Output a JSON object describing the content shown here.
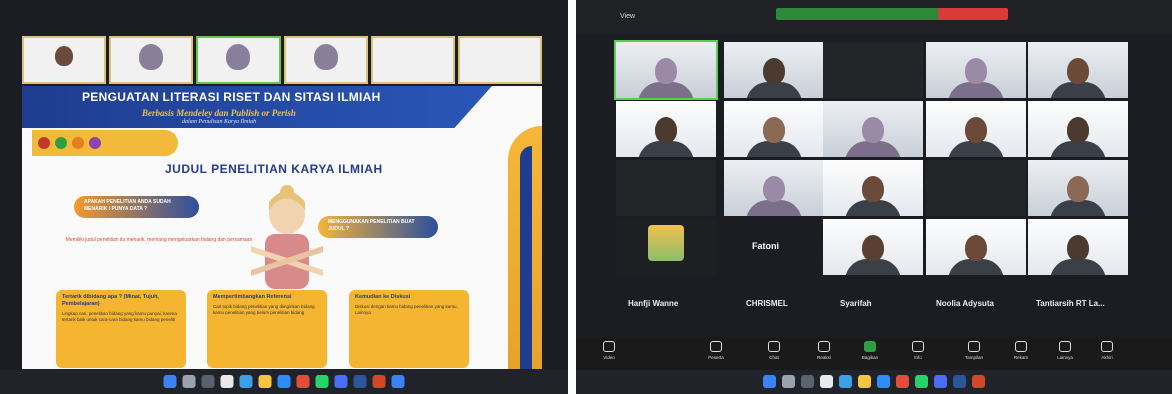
{
  "left": {
    "participants": [
      {
        "name": ""
      },
      {
        "name": ""
      },
      {
        "name": ""
      },
      {
        "name": ""
      },
      {
        "name": ""
      },
      {
        "name": ""
      }
    ],
    "slide": {
      "title": "PENGUATAN LITERASI RISET DAN SITASI ILMIAH",
      "subtitle": "Berbasis Mendeley dan Publish or Perish",
      "subtitle2": "dalam Penulisan Karya Ilmiah",
      "heading": "JUDUL PENELITIAN KARYA ILMIAH",
      "pill_a": "APAKAH PENELITIAN ANDA SUDAH MENARIK / PUNYA DATA ?",
      "pill_b": "MENGGUNAKAN PENELITIAN BUAT JUDUL ?",
      "note": "Memiliki judul penelitian itu menarik, memang mengeluarkan bidang dan persamaan",
      "cards": [
        {
          "title": "Tertarik dibidang apa ? (Minat, Tujuh, Pembelajaran)",
          "body": "Lingkup cari, penelitian bidang yang kamu punyai, karena tertarik baik untuk cara-cara bidang kamu bidang peneliti"
        },
        {
          "title": "Mempertimbangkan Referensi",
          "body": "Cari topik bidang penelitian yang diinginkan bidang kamu penelitian yang belum penelitian bidang"
        },
        {
          "title": "Kemudian ke Diskusi",
          "body": "Diskusi dengan kamu bidang penelitian yang kamu, Lainnya"
        }
      ]
    },
    "tray_text": ""
  },
  "right": {
    "topbar": {
      "view": "View",
      "recording": "",
      "stop": "",
      "right_text": ""
    },
    "tiles": [
      {
        "name": "",
        "kind": "veil"
      },
      {
        "name": "",
        "kind": "face"
      },
      {
        "name": "",
        "kind": "dark"
      },
      {
        "name": "",
        "kind": "veil"
      },
      {
        "name": "",
        "kind": "face"
      },
      {
        "name": "",
        "kind": "bright"
      },
      {
        "name": "",
        "kind": "bright"
      },
      {
        "name": "",
        "kind": "veil"
      },
      {
        "name": "",
        "kind": "bright"
      },
      {
        "name": "",
        "kind": "bright"
      },
      {
        "name": "",
        "kind": "dark"
      },
      {
        "name": "",
        "kind": "veil"
      },
      {
        "name": "",
        "kind": "bright"
      },
      {
        "name": "",
        "kind": "dark"
      },
      {
        "name": "",
        "kind": "face"
      },
      {
        "name": "",
        "kind": "bright"
      },
      {
        "name": "",
        "kind": "bright"
      },
      {
        "name": "",
        "kind": "bright"
      },
      {
        "name": "",
        "kind": "bright"
      }
    ],
    "fathoni": "Fatoni",
    "avatar_label": "",
    "bottom_names": [
      "Hanfji Wanne",
      "CHRISMEL",
      "Syarifah",
      "Noolia Adysuta",
      "Tantiarsih RT La..."
    ],
    "bottom_subnames": [
      "",
      "",
      "",
      "",
      ""
    ],
    "controls": [
      "Video",
      "Peserta",
      "Chat",
      "Reaksi",
      "Bagikan",
      "Info",
      "Tampilan",
      "Rekam",
      "Lainnya",
      "Akhiri"
    ]
  },
  "colors": {
    "accent_blue": "#1e3d8f",
    "accent_orange": "#f5b531",
    "zoom_green": "#2c8a3a",
    "stop_red": "#d93a3a"
  }
}
